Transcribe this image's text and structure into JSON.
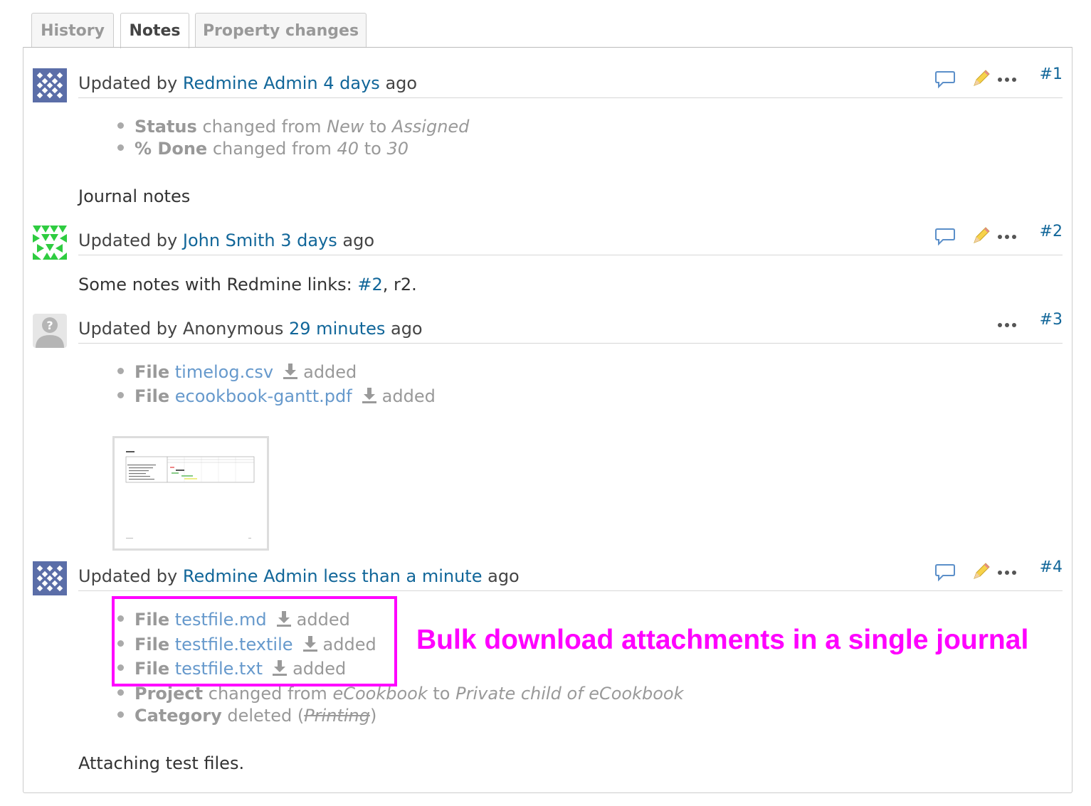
{
  "tabs": [
    {
      "label": "History",
      "selected": false
    },
    {
      "label": "Notes",
      "selected": true
    },
    {
      "label": "Property changes",
      "selected": false
    }
  ],
  "journals": [
    {
      "number": "#1",
      "updated_by_prefix": "Updated by",
      "author": "Redmine Admin",
      "time": "4 days",
      "suffix": "ago",
      "details": [
        {
          "field": "Status",
          "text": "changed from",
          "old": "New",
          "to": "to",
          "new": "Assigned"
        },
        {
          "field": "% Done",
          "text": "changed from",
          "old": "40",
          "to": "to",
          "new": "30"
        }
      ],
      "notes": "Journal notes"
    },
    {
      "number": "#2",
      "updated_by_prefix": "Updated by",
      "author": "John Smith",
      "time": "3 days",
      "suffix": "ago",
      "notes_prefix": "Some notes with Redmine links: ",
      "notes_link": "#2",
      "notes_suffix": ", r2."
    },
    {
      "number": "#3",
      "updated_by_prefix": "Updated by",
      "author": "Anonymous",
      "time": "29 minutes",
      "suffix": "ago",
      "files": [
        {
          "label": "File",
          "name": "timelog.csv",
          "action": "added"
        },
        {
          "label": "File",
          "name": "ecookbook-gantt.pdf",
          "action": "added"
        }
      ]
    },
    {
      "number": "#4",
      "updated_by_prefix": "Updated by",
      "author": "Redmine Admin",
      "time": "less than a minute",
      "suffix": "ago",
      "files": [
        {
          "label": "File",
          "name": "testfile.md",
          "action": "added"
        },
        {
          "label": "File",
          "name": "testfile.textile",
          "action": "added"
        },
        {
          "label": "File",
          "name": "testfile.txt",
          "action": "added"
        }
      ],
      "details": [
        {
          "field": "Project",
          "text": "changed from",
          "old": "eCookbook",
          "to": "to",
          "new": "Private child of eCookbook"
        },
        {
          "field": "Category",
          "text": "deleted",
          "old": "Printing"
        }
      ],
      "notes": "Attaching test files."
    }
  ],
  "annotation": "Bulk download attachments in a single journal",
  "colors": {
    "link": "#116699",
    "file_link": "#6699cc",
    "highlight": "#ff00ff"
  }
}
